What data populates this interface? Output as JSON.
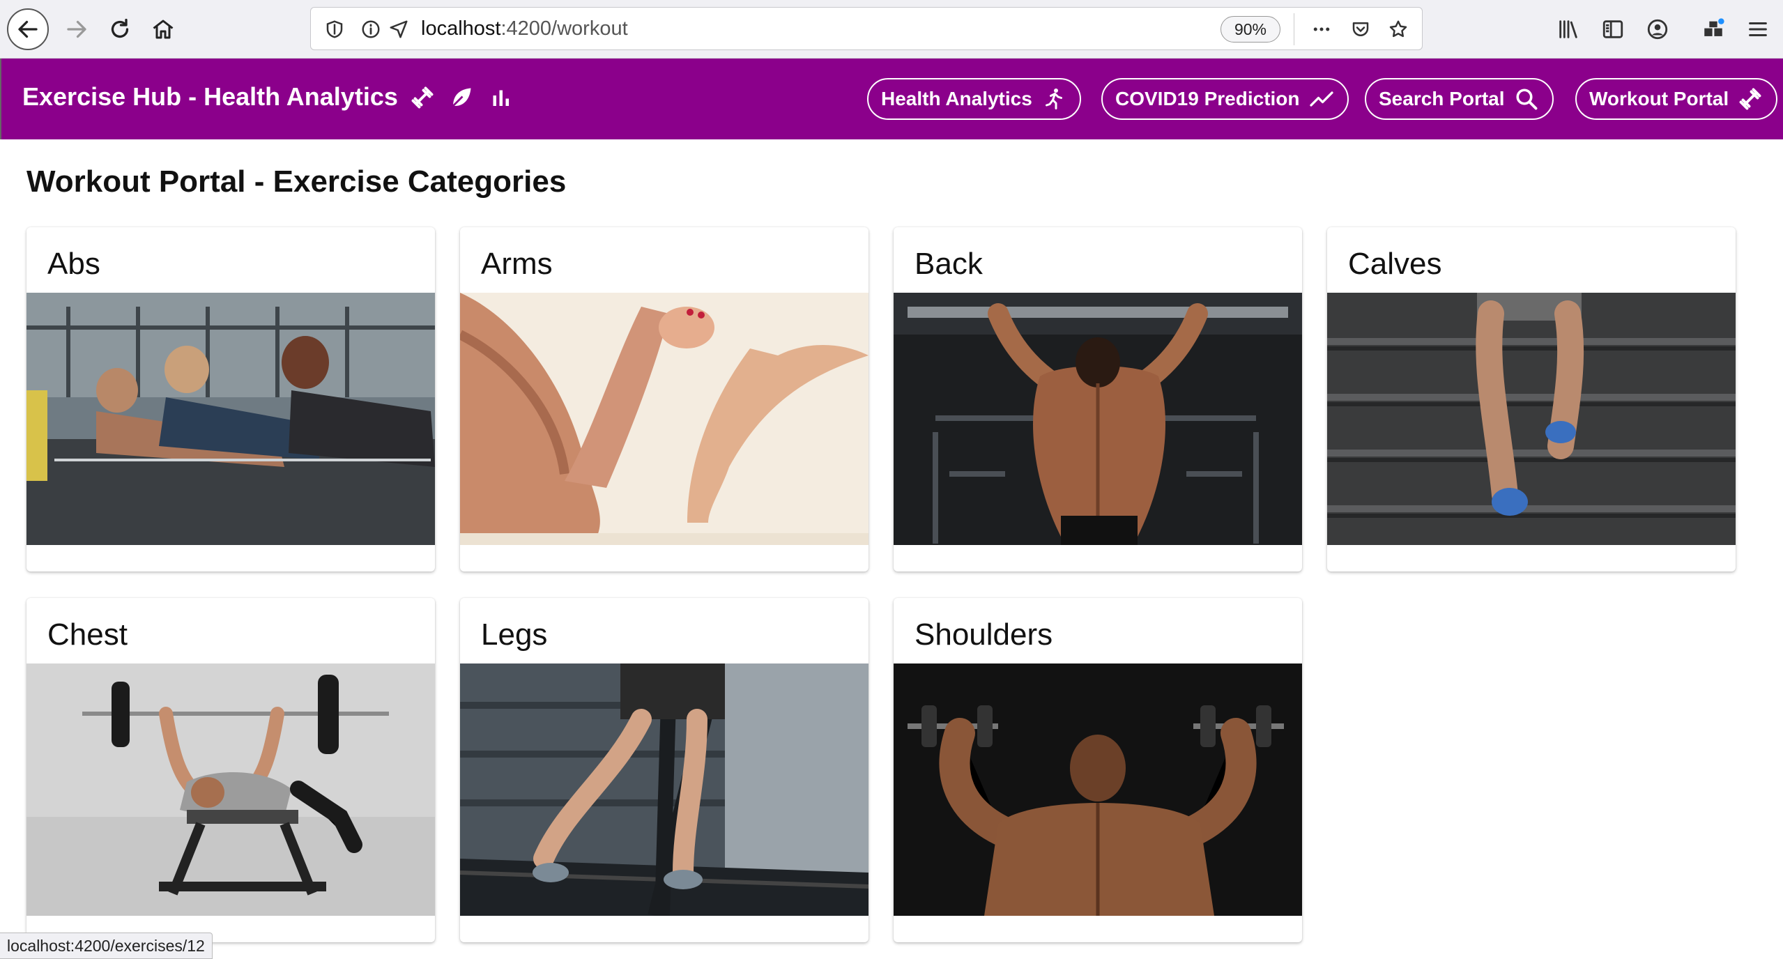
{
  "browser": {
    "url_host": "localhost",
    "url_path": ":4200/workout",
    "zoom": "90%",
    "status_url": "localhost:4200/exercises/12"
  },
  "app": {
    "brand": "Exercise Hub - Health Analytics",
    "brand_icons": [
      "dumbbell-icon",
      "leaf-icon",
      "bar-chart-icon"
    ],
    "nav": [
      {
        "label": "Health Analytics",
        "icon": "running-person-icon"
      },
      {
        "label": "COVID19 Prediction",
        "icon": "trending-up-icon"
      },
      {
        "label": "Search Portal",
        "icon": "search-icon"
      },
      {
        "label": "Workout Portal",
        "icon": "dumbbell-icon"
      }
    ],
    "accent_color": "#8b008b"
  },
  "page": {
    "title": "Workout Portal - Exercise Categories",
    "categories": [
      {
        "name": "Abs"
      },
      {
        "name": "Arms"
      },
      {
        "name": "Back"
      },
      {
        "name": "Calves"
      },
      {
        "name": "Chest"
      },
      {
        "name": "Legs"
      },
      {
        "name": "Shoulders"
      }
    ]
  }
}
